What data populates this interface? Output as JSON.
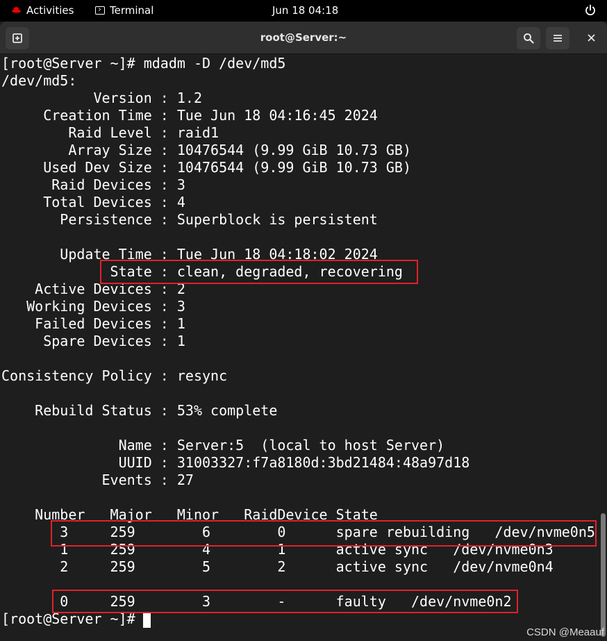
{
  "topbar": {
    "activities": "Activities",
    "app_name": "Terminal",
    "clock": "Jun 18  04:18"
  },
  "window": {
    "title": "root@Server:~"
  },
  "terminal": {
    "lines": [
      "[root@Server ~]# mdadm -D /dev/md5",
      "/dev/md5:",
      "           Version : 1.2",
      "     Creation Time : Tue Jun 18 04:16:45 2024",
      "        Raid Level : raid1",
      "        Array Size : 10476544 (9.99 GiB 10.73 GB)",
      "     Used Dev Size : 10476544 (9.99 GiB 10.73 GB)",
      "      Raid Devices : 3",
      "     Total Devices : 4",
      "       Persistence : Superblock is persistent",
      "",
      "       Update Time : Tue Jun 18 04:18:02 2024",
      "             State : clean, degraded, recovering",
      "    Active Devices : 2",
      "   Working Devices : 3",
      "    Failed Devices : 1",
      "     Spare Devices : 1",
      "",
      "Consistency Policy : resync",
      "",
      "    Rebuild Status : 53% complete",
      "",
      "              Name : Server:5  (local to host Server)",
      "              UUID : 31003327:f7a8180d:3bd21484:48a97d18",
      "            Events : 27",
      "",
      "    Number   Major   Minor   RaidDevice State",
      "       3     259        6        0      spare rebuilding   /dev/nvme0n5",
      "       1     259        4        1      active sync   /dev/nvme0n3",
      "       2     259        5        2      active sync   /dev/nvme0n4",
      "",
      "       0     259        3        -      faulty   /dev/nvme0n2",
      "[root@Server ~]# "
    ]
  },
  "watermark": "CSDN @Meaauf",
  "colors": {
    "terminal_bg": "#1e1e1e",
    "headerbar_bg": "#2f2f2f",
    "highlight_border": "#e0222b"
  }
}
